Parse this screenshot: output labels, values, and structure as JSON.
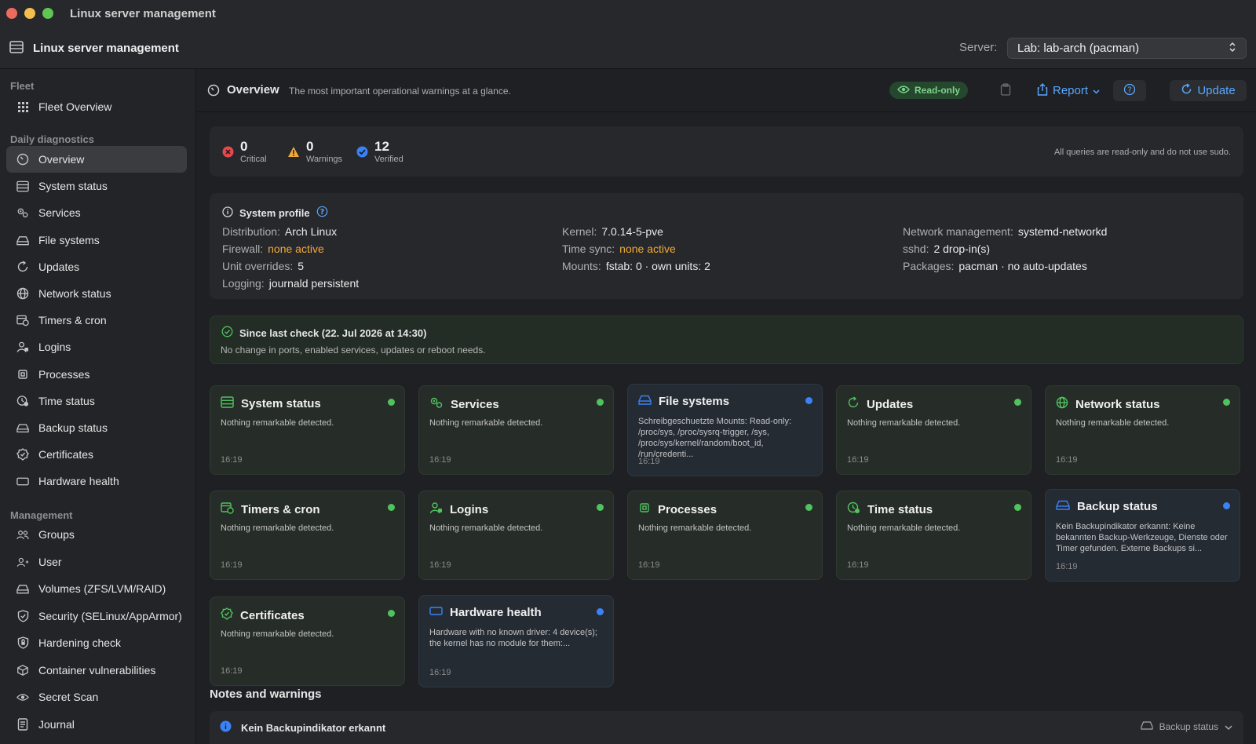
{
  "window": {
    "title": "Linux server management"
  },
  "header": {
    "app_title": "Linux server management",
    "server_label": "Server:",
    "server_value": "Lab: lab-arch (pacman)"
  },
  "sidebar": {
    "sections": [
      {
        "label": "Fleet",
        "items": [
          {
            "label": "Fleet Overview",
            "icon": "grid-icon"
          }
        ]
      },
      {
        "label": "Daily diagnostics",
        "items": [
          {
            "label": "Overview",
            "icon": "gauge-icon",
            "active": true
          },
          {
            "label": "System status",
            "icon": "server-icon"
          },
          {
            "label": "Services",
            "icon": "gears-icon"
          },
          {
            "label": "File systems",
            "icon": "drive-icon"
          },
          {
            "label": "Updates",
            "icon": "refresh-icon"
          },
          {
            "label": "Network status",
            "icon": "globe-icon"
          },
          {
            "label": "Timers & cron",
            "icon": "calendar-clock-icon"
          },
          {
            "label": "Logins",
            "icon": "user-lock-icon"
          },
          {
            "label": "Processes",
            "icon": "cpu-icon"
          },
          {
            "label": "Time status",
            "icon": "clock-icon"
          },
          {
            "label": "Backup status",
            "icon": "backup-drive-icon"
          },
          {
            "label": "Certificates",
            "icon": "seal-icon"
          },
          {
            "label": "Hardware health",
            "icon": "hardware-icon"
          }
        ]
      },
      {
        "label": "Management",
        "items": [
          {
            "label": "Groups",
            "icon": "users-icon"
          },
          {
            "label": "User",
            "icon": "user-icon"
          },
          {
            "label": "Volumes (ZFS/LVM/RAID)",
            "icon": "volume-drive-icon"
          },
          {
            "label": "Security (SELinux/AppArmor)",
            "icon": "shield-icon"
          },
          {
            "label": "Hardening check",
            "icon": "lock-shield-icon"
          },
          {
            "label": "Container vulnerabilities",
            "icon": "cube-icon"
          },
          {
            "label": "Secret Scan",
            "icon": "eye-icon"
          },
          {
            "label": "Journal",
            "icon": "journal-icon"
          }
        ]
      }
    ]
  },
  "toolbar": {
    "title": "Overview",
    "subtitle": "The most important operational warnings at a glance.",
    "readonly_label": "Read-only",
    "report_label": "Report",
    "update_label": "Update"
  },
  "summary": {
    "critical": {
      "value": "0",
      "label": "Critical"
    },
    "warnings": {
      "value": "0",
      "label": "Warnings"
    },
    "verified": {
      "value": "12",
      "label": "Verified"
    },
    "note": "All queries are read-only and do not use sudo."
  },
  "profile": {
    "title": "System profile",
    "rows": [
      {
        "k": "Distribution:",
        "v": "Arch Linux"
      },
      {
        "k": "Firewall:",
        "v": "none active",
        "warn": true
      },
      {
        "k": "Unit overrides:",
        "v": "5"
      },
      {
        "k": "Logging:",
        "v": "journald persistent"
      },
      {
        "k": "Kernel:",
        "v": "7.0.14-5-pve"
      },
      {
        "k": "Time sync:",
        "v": "none active",
        "warn": true
      },
      {
        "k": "Mounts:",
        "v": "fstab: 0 · own units: 2"
      },
      {
        "k": "Network management:",
        "v": "systemd-networkd"
      },
      {
        "k": "sshd:",
        "v": "2 drop-in(s)"
      },
      {
        "k": "Packages:",
        "v": "pacman · no auto-updates"
      }
    ]
  },
  "since": {
    "title": "Since last check (22. Jul 2026 at 14:30)",
    "text": "No change in ports, enabled services, updates or reboot needs."
  },
  "cards": [
    {
      "title": "System status",
      "text": "Nothing remarkable detected.",
      "time": "16:19",
      "status": "ok",
      "icon": "server-icon"
    },
    {
      "title": "Services",
      "text": "Nothing remarkable detected.",
      "time": "16:19",
      "status": "ok",
      "icon": "gears-icon"
    },
    {
      "title": "File systems",
      "text": "Schreibgeschuetzte Mounts: Read-only: /proc/sys, /proc/sysrq-trigger, /sys, /proc/sys/kernel/random/boot_id, /run/credenti...",
      "time": "16:19",
      "status": "info",
      "icon": "drive-icon"
    },
    {
      "title": "Updates",
      "text": "Nothing remarkable detected.",
      "time": "16:19",
      "status": "ok",
      "icon": "refresh-icon"
    },
    {
      "title": "Network status",
      "text": "Nothing remarkable detected.",
      "time": "16:19",
      "status": "ok",
      "icon": "globe-icon"
    },
    {
      "title": "Timers & cron",
      "text": "Nothing remarkable detected.",
      "time": "16:19",
      "status": "ok",
      "icon": "calendar-clock-icon"
    },
    {
      "title": "Logins",
      "text": "Nothing remarkable detected.",
      "time": "16:19",
      "status": "ok",
      "icon": "user-lock-icon"
    },
    {
      "title": "Processes",
      "text": "Nothing remarkable detected.",
      "time": "16:19",
      "status": "ok",
      "icon": "cpu-icon"
    },
    {
      "title": "Time status",
      "text": "Nothing remarkable detected.",
      "time": "16:19",
      "status": "ok",
      "icon": "clock-icon"
    },
    {
      "title": "Backup status",
      "text": "Kein Backupindikator erkannt: Keine bekannten Backup-Werkzeuge, Dienste oder Timer gefunden. Externe Backups si...",
      "time": "16:19",
      "status": "info",
      "icon": "backup-drive-icon"
    },
    {
      "title": "Certificates",
      "text": "Nothing remarkable detected.",
      "time": "16:19",
      "status": "ok",
      "icon": "seal-icon"
    },
    {
      "title": "Hardware health",
      "text": "Hardware with no known driver: 4 device(s); the kernel has no module for them:...",
      "time": "16:19",
      "status": "info",
      "icon": "hardware-icon"
    }
  ],
  "notes": {
    "title": "Notes and warnings",
    "first": {
      "title": "Kein Backupindikator erkannt",
      "category": "Backup status"
    }
  },
  "colors": {
    "ok": "#4fc35d",
    "info": "#3b82f6",
    "warn": "#f0a93b",
    "critical": "#e5484d",
    "accent": "#5aa8ff"
  }
}
